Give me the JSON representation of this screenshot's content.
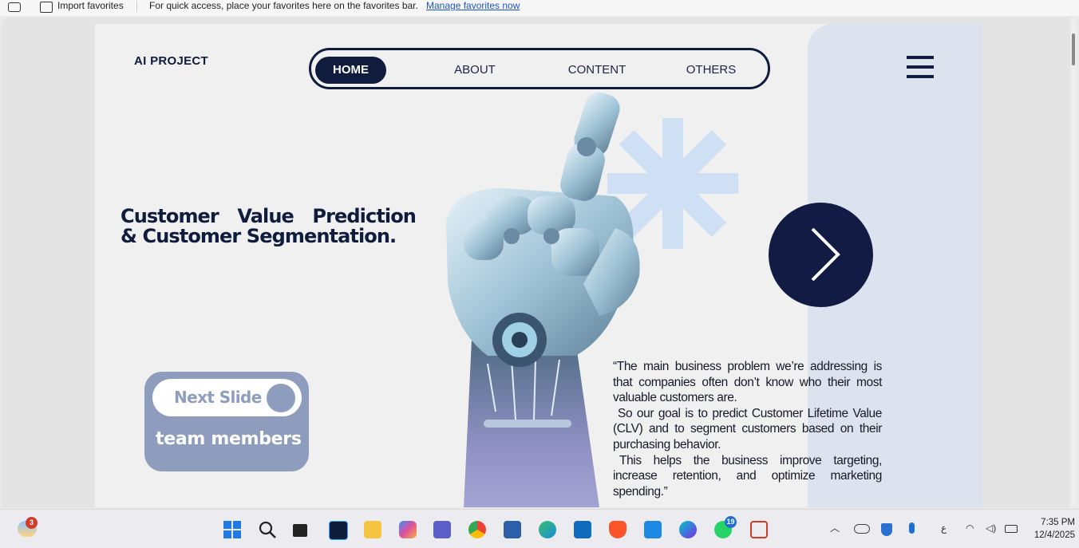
{
  "favorites_bar": {
    "import_label": "Import favorites",
    "message": "For quick access, place your favorites here on the favorites bar.",
    "manage_link": "Manage favorites now"
  },
  "page": {
    "brand": "AI PROJECT",
    "nav": [
      {
        "label": "HOME",
        "active": true
      },
      {
        "label": "ABOUT"
      },
      {
        "label": "CONTENT"
      },
      {
        "label": "OTHERS"
      }
    ],
    "headline_line1": "Customer Value Prediction",
    "headline_line2": "& Customer Segmentation.",
    "next_slide_label": "Next Slide",
    "team_label": "team members",
    "quote": [
      "“The main business problem we’re addressing is that companies often don’t know who their most valuable customers are.",
      "So our goal is to predict Customer Lifetime Value (CLV) and to segment customers based on their purchasing behavior.",
      "This helps the business improve targeting, increase retention, and optimize marketing spending.”"
    ],
    "colors": {
      "navy": "#0f1c3d",
      "slate": "#8e9cbd",
      "panel": "#dde3ee",
      "asterisk": "#cfe0f5"
    }
  },
  "taskbar": {
    "weather_badge": "3",
    "whatsapp_badge": "19",
    "time": "7:35 PM",
    "date": "12/4/2025",
    "lang": "ع",
    "icons": [
      "weather-icon",
      "start-icon",
      "search-icon",
      "task-view-icon",
      "photoshop-icon",
      "file-explorer-icon",
      "copilot-icon",
      "teams-icon",
      "chrome-icon",
      "store-icon",
      "edge-icon",
      "outlook-icon",
      "brave-icon",
      "vscode-icon",
      "canva-icon",
      "whatsapp-icon",
      "snipping-tool-icon"
    ]
  }
}
